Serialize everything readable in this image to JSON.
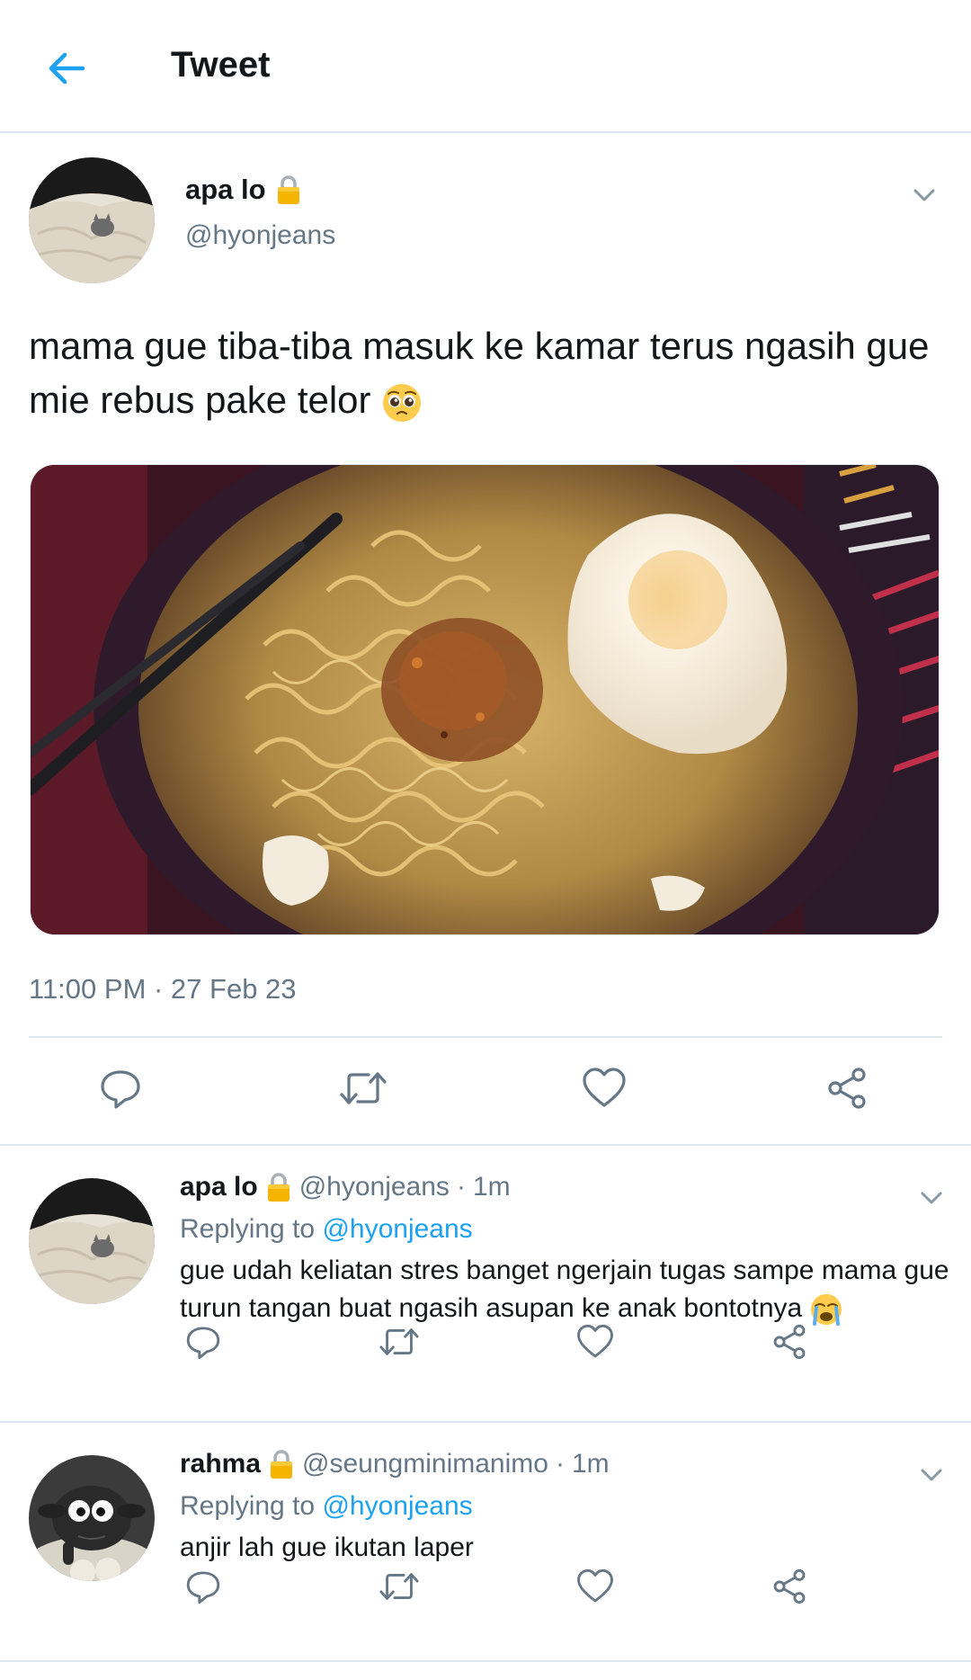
{
  "header": {
    "title": "Tweet",
    "back_icon": "arrow-left-icon"
  },
  "tweet": {
    "author_name": "apa lo",
    "author_handle": "@hyonjeans",
    "protected_icon": "lock-icon",
    "text": "mama gue tiba-tiba masuk ke kamar terus ngasih gue mie rebus pake telor",
    "emoji": "pleading-face",
    "timestamp": "11:00 PM · 27 Feb 23",
    "media_description": "bowl of instant noodles with poached egg and fried shallots",
    "actions": [
      "reply-icon",
      "retweet-icon",
      "like-icon",
      "share-icon"
    ]
  },
  "replies": [
    {
      "author_name": "apa lo",
      "author_handle": "@hyonjeans",
      "time": "1m",
      "replying_prefix": "Replying to",
      "replying_to": "@hyonjeans",
      "text": "gue udah keliatan stres banget ngerjain tugas sampe mama gue turun tangan buat ngasih asupan ke anak bontotnya",
      "emoji": "loudly-crying-face"
    },
    {
      "author_name": "rahma",
      "author_handle": "@seungminimanimo",
      "time": "1m",
      "replying_prefix": "Replying to",
      "replying_to": "@hyonjeans",
      "text": "anjir lah gue ikutan laper",
      "emoji": ""
    }
  ],
  "colors": {
    "accent": "#1da1f2",
    "secondary_text": "#657786",
    "primary_text": "#14171a",
    "divider": "#e1e8ed",
    "icon": "#657786"
  }
}
